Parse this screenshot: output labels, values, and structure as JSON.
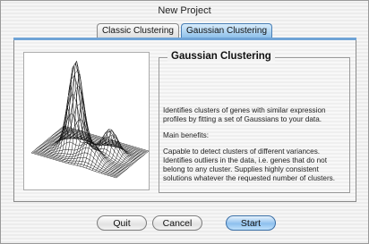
{
  "window": {
    "title": "New Project"
  },
  "tabs": [
    {
      "label": "Classic Clustering",
      "active": false
    },
    {
      "label": "Gaussian Clustering",
      "active": true
    }
  ],
  "panel": {
    "group_title": "Gaussian Clustering",
    "paragraphs": [
      "Identifies clusters of genes with similar expression profiles by fitting a set of Gaussians to your data.",
      "Main benefits:",
      "Capable to detect clusters of different variances. Identifies outliers in the data, i.e. genes that do not belong to any cluster. Supplies highly consistent solutions whatever the requested number of clusters."
    ]
  },
  "buttons": {
    "quit": "Quit",
    "cancel": "Cancel",
    "start": "Start"
  },
  "colors": {
    "accent": "#6fa3d6",
    "default_button": "#8ec0ee"
  }
}
